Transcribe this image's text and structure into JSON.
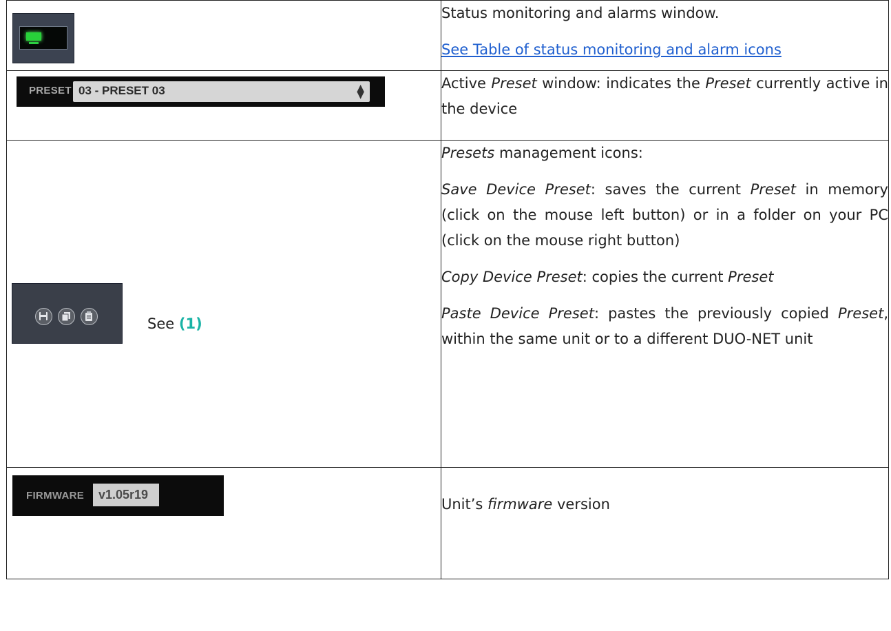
{
  "rows": [
    {
      "image": "status-monitoring-window",
      "lines": [
        "Status monitoring and alarms window."
      ],
      "link": "See Table of status monitoring and alarm icons"
    },
    {
      "image": "active-preset-window",
      "widget": {
        "label": "PRESET",
        "value": "03 - PRESET 03"
      },
      "text": {
        "a": "Active ",
        "b": "Preset",
        "c": " window: indicates the ",
        "d": "Preset",
        "e": " currently active in the device"
      }
    },
    {
      "image": "presets-management-icons",
      "icons": [
        "save-preset-icon",
        "copy-preset-icon",
        "paste-preset-icon"
      ],
      "see": {
        "prefix": "See ",
        "ref": "(1)"
      },
      "intro": {
        "a": "Presets",
        "b": " management icons:"
      },
      "save": {
        "a": "Save Device Preset",
        "b": ": saves the current ",
        "c": "Preset",
        "d": " in memory (click on the mouse left button) or in a folder on your PC (click on the mouse right button)"
      },
      "copy": {
        "a": "Copy Device Preset",
        "b": ": copies the current ",
        "c": "Preset"
      },
      "paste": {
        "a": "Paste Device Preset",
        "b": ": pastes the previously copied ",
        "c": "Preset",
        "d": ", within the same unit or to a different DUO-NET unit"
      }
    },
    {
      "image": "firmware-version-field",
      "widget": {
        "label": "FIRMWARE",
        "value": "v1.05r19"
      },
      "text": {
        "a": "Unit’s ",
        "b": "firmware",
        "c": " version"
      }
    }
  ],
  "colors": {
    "link": "#1f5fcf",
    "reference": "#1ab3a6",
    "status_led": "#28d13a"
  }
}
